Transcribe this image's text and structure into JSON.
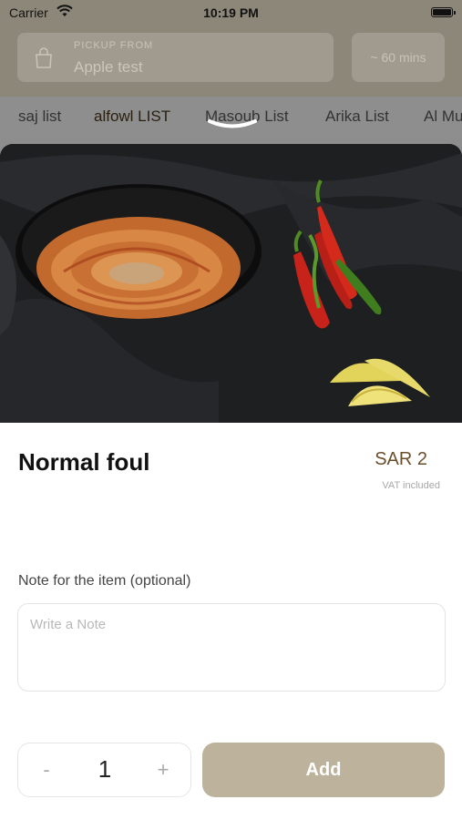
{
  "status_bar": {
    "carrier": "Carrier",
    "time": "10:19 PM"
  },
  "header": {
    "pickup_label": "PICKUP FROM",
    "pickup_value": "Apple test",
    "time_estimate": "~ 60 mins"
  },
  "tabs": [
    {
      "label": "saj list"
    },
    {
      "label": "alfowl LIST"
    },
    {
      "label": "Masoub List"
    },
    {
      "label": "Arika List"
    },
    {
      "label": "Al Mu"
    }
  ],
  "active_tab": "alfowl LIST",
  "item": {
    "name": "Normal foul",
    "price": "SAR 2",
    "vat_note": "VAT included"
  },
  "note": {
    "label": "Note for the item (optional)",
    "placeholder": "Write a Note",
    "value": ""
  },
  "quantity": {
    "minus_label": "-",
    "value": "1",
    "plus_label": "+"
  },
  "add_label": "Add",
  "colors": {
    "accent": "#bdb29c",
    "price_text": "#6b4f2d",
    "header_bg": "#8c8779"
  }
}
